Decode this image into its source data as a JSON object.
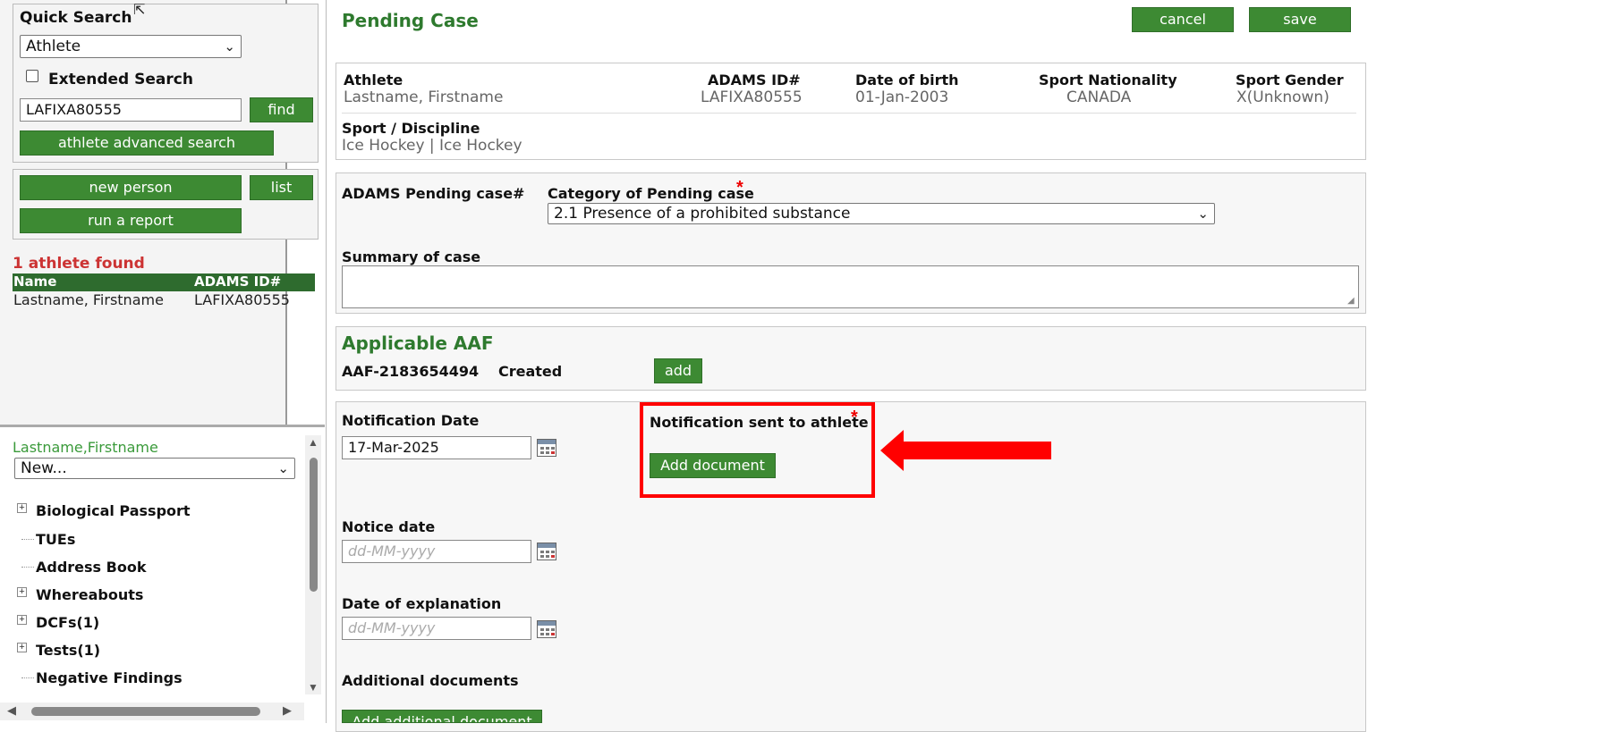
{
  "sidebar": {
    "quick_search_title": "Quick Search",
    "search_type": "Athlete",
    "extended_search_label": "Extended Search",
    "search_value": "LAFIXA80555",
    "find_button": "find",
    "advanced_search_button": "athlete advanced search",
    "new_person_button": "new person",
    "list_button": "list",
    "run_report_button": "run a report",
    "results_count": "1 athlete found",
    "results_headers": [
      "Name",
      "ADAMS ID#"
    ],
    "results_rows": [
      [
        "Lastname, Firstname",
        "LAFIXA80555"
      ]
    ],
    "selected_person": "Lastname,Firstname",
    "new_select_value": "New...",
    "tree_items": [
      "Biological Passport",
      "TUEs",
      "Address Book",
      "Whereabouts",
      "DCFs(1)",
      "Tests(1)",
      "Negative Findings"
    ]
  },
  "main": {
    "title": "Pending Case",
    "cancel_button": "cancel",
    "save_button": "save",
    "athlete": {
      "athlete_label": "Athlete",
      "athlete_value": "Lastname, Firstname",
      "adams_label": "ADAMS ID#",
      "adams_value": "LAFIXA80555",
      "dob_label": "Date of birth",
      "dob_value": "01-Jan-2003",
      "nationality_label": "Sport Nationality",
      "nationality_value": "CANADA",
      "gender_label": "Sport Gender",
      "gender_value": "X(Unknown)",
      "sport_label": "Sport / Discipline",
      "sport_value": "Ice Hockey | Ice Hockey"
    },
    "case": {
      "pending_case_label": "ADAMS Pending case#",
      "category_label": "Category of Pending case",
      "required_mark": "*",
      "category_value": "2.1 Presence of a prohibited substance",
      "summary_label": "Summary of case"
    },
    "aaf": {
      "title": "Applicable AAF",
      "id": "AAF-2183654494",
      "status": "Created",
      "add_button": "add"
    },
    "dates": {
      "notification_date_label": "Notification Date",
      "notification_date_value": "17-Mar-2025",
      "notification_sent_label": "Notification sent to athlete",
      "required_mark": "*",
      "add_document_button": "Add document",
      "notice_date_label": "Notice date",
      "date_placeholder": "dd-MM-yyyy",
      "explanation_label": "Date of explanation",
      "additional_documents_label": "Additional documents",
      "add_additional_button": "Add additional document"
    },
    "highlight_color": "#ff0000",
    "brand_green": "#3d8a33"
  }
}
